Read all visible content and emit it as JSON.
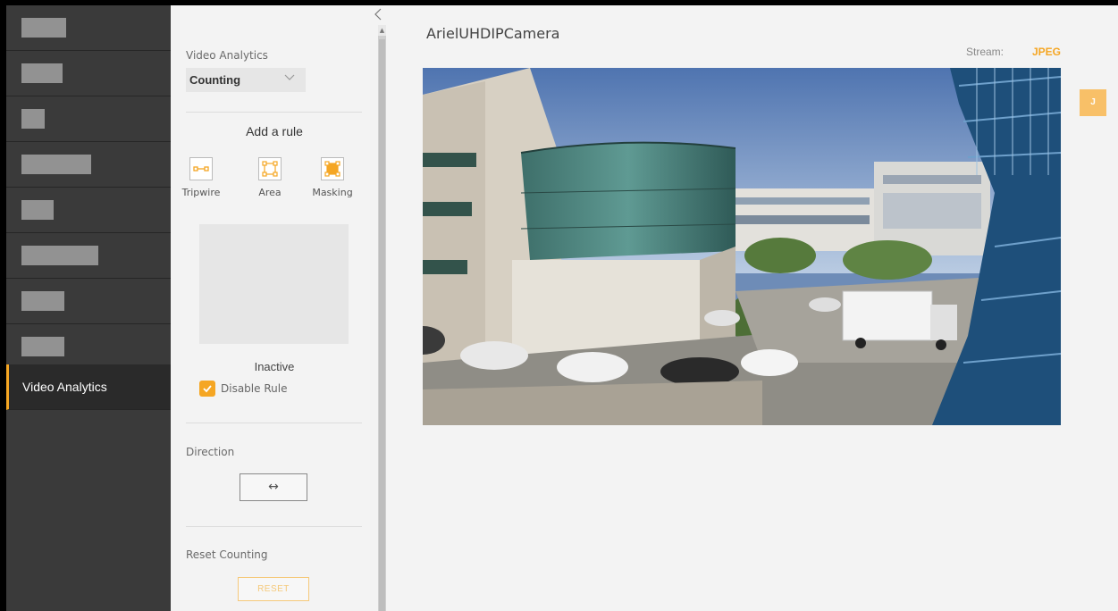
{
  "sidebar": {
    "items": [
      {
        "label": "",
        "redacted": true
      },
      {
        "label": "",
        "redacted": true
      },
      {
        "label": "",
        "redacted": true
      },
      {
        "label": "",
        "redacted": true
      },
      {
        "label": "",
        "redacted": true
      },
      {
        "label": "",
        "redacted": true
      },
      {
        "label": "",
        "redacted": true
      },
      {
        "label": "",
        "redacted": true
      },
      {
        "label": "Video Analytics",
        "active": true
      }
    ],
    "accent_color": "#f5a623"
  },
  "panel": {
    "collapse_icon": "chevron-left-icon",
    "analytics_label": "Video Analytics",
    "analytics_value": "Counting",
    "add_rule_title": "Add a rule",
    "rule_types": [
      "Tripwire",
      "Area",
      "Masking"
    ],
    "rule_status": "Inactive",
    "disable_rule_label": "Disable Rule",
    "disable_rule_checked": true,
    "direction_label": "Direction",
    "direction_value": "↔",
    "reset_counting_label": "Reset Counting",
    "reset_button": "RESET"
  },
  "main": {
    "camera_title": "ArielUHDIPCamera",
    "stream_label": "Stream:",
    "stream_value": "JPEG",
    "user_badge": "J"
  }
}
